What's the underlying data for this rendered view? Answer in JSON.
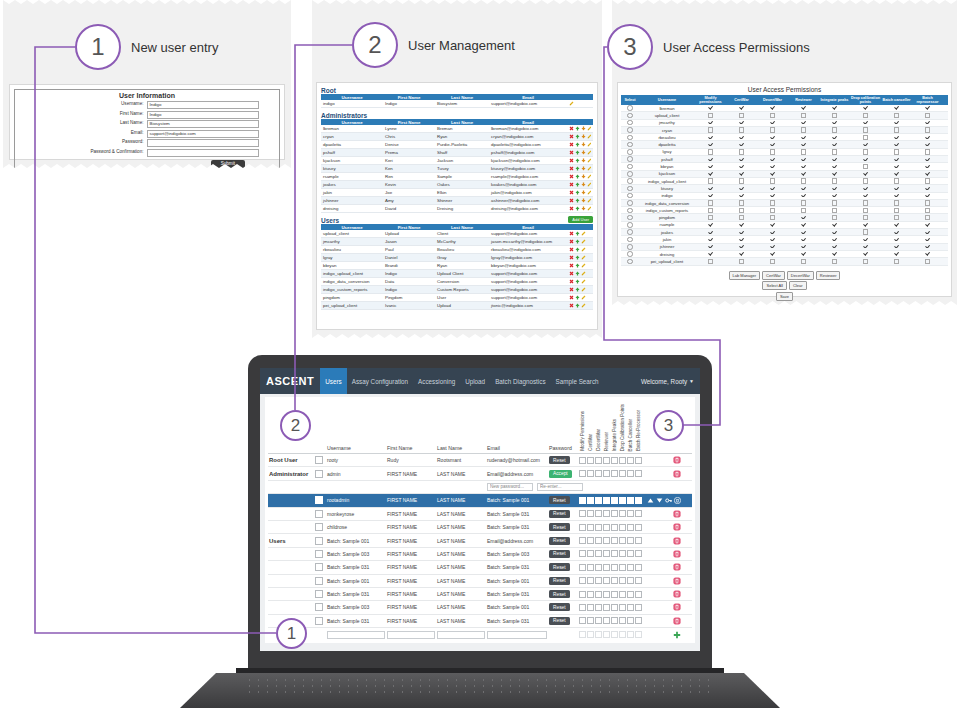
{
  "callouts": [
    {
      "number": "1",
      "title": "New user entry"
    },
    {
      "number": "2",
      "title": "User Management"
    },
    {
      "number": "3",
      "title": "User Access Permissions"
    }
  ],
  "new_user_form": {
    "title": "User Information",
    "fields": [
      {
        "label": "Username:",
        "value": "Indigo"
      },
      {
        "label": "First Name:",
        "value": "Indigo"
      },
      {
        "label": "Last Name:",
        "value": "Biosystem"
      },
      {
        "label": "Email:",
        "value": "support@indigobio.com"
      },
      {
        "label": "Password:",
        "value": ""
      },
      {
        "label": "Password & Confirmation:",
        "value": ""
      }
    ],
    "submit": "Submit"
  },
  "user_management": {
    "columns": [
      "Username",
      "First Name",
      "Last Name",
      "Email"
    ],
    "sections": [
      {
        "title": "Root",
        "kind": "root",
        "rows": [
          [
            "indigo",
            "Indigo",
            "Biosystem",
            "support@indigobio.com"
          ]
        ]
      },
      {
        "title": "Administrators",
        "kind": "admin",
        "rows": [
          [
            "lbreman",
            "Lynne",
            "Breman",
            "lbreman@indigobio.com"
          ],
          [
            "cryan",
            "Chris",
            "Ryan",
            "cryan@indigobio.com"
          ],
          [
            "dpaoletta",
            "Denise",
            "Purdie-Paoletta",
            "dpaoletta@indigobio.com"
          ],
          [
            "pshaff",
            "Prema",
            "Shaff",
            "pshaff@indigobio.com"
          ],
          [
            "kjackson",
            "Keri",
            "Jackson",
            "kjackson@indigobio.com"
          ],
          [
            "ktusey",
            "Ken",
            "Tusey",
            "ktusey@indigobio.com"
          ],
          [
            "rsample",
            "Ren",
            "Sample",
            "rsample@indigobio.com"
          ],
          [
            "joakes",
            "Kevin",
            "Oakes",
            "koakes@indigobio.com"
          ],
          [
            "jakin",
            "Joe",
            "Elkin",
            "jakin@indigobio.com"
          ],
          [
            "jshinner",
            "Amy",
            "Shinner",
            "ashinner@indigobio.com"
          ],
          [
            "dreising",
            "David",
            "Dreising",
            "dreising@indigobio.com"
          ]
        ]
      },
      {
        "title": "Users",
        "kind": "user",
        "add_button": "Add User",
        "rows": [
          [
            "upload_client",
            "Upload",
            "Client",
            "support@indigobio.com"
          ],
          [
            "jmcarthy",
            "Jason",
            "McCarthy",
            "jason.mccarthy@indigobio.com"
          ],
          [
            "rbeaulieu",
            "Paul",
            "Beaulieu",
            "rbeaulieu@indigobio.com"
          ],
          [
            "lgray",
            "Daniel",
            "Gray",
            "lgray@indigobio.com"
          ],
          [
            "bbryan",
            "Brandi",
            "Ryan",
            "bbryan@indigobio.com"
          ],
          [
            "indigo_upload_client",
            "Indigo",
            "Upload Client",
            "support@indigobio.com"
          ],
          [
            "indigo_data_conversion",
            "Data",
            "Conversion",
            "support@indigobio.com"
          ],
          [
            "indigo_custom_reports",
            "Indigo",
            "Custom Reports",
            "support@indigobio.com"
          ],
          [
            "pingdom",
            "Pingdom",
            "User",
            "support@indigobio.com"
          ],
          [
            "pei_upload_client",
            "Ivanic",
            "Upload",
            "jtonic@indigobio.com"
          ]
        ]
      }
    ]
  },
  "access_permissions": {
    "title": "User Access Permissions",
    "columns": [
      "Select",
      "Username",
      "Modify permissions",
      "CertWar",
      "DecertWar",
      "Reviewer",
      "Integrate peaks",
      "Drop calibration points",
      "Batch canceller",
      "Batch reprocessor"
    ],
    "rows": [
      {
        "username": "lbreman",
        "selected": false,
        "permissions": [
          true,
          true,
          true,
          true,
          true,
          true,
          true,
          true
        ]
      },
      {
        "username": "upload_client",
        "selected": false,
        "permissions": [
          false,
          false,
          false,
          false,
          false,
          false,
          false,
          false
        ]
      },
      {
        "username": "jmcarthy",
        "selected": false,
        "permissions": [
          true,
          true,
          true,
          true,
          true,
          true,
          true,
          true
        ]
      },
      {
        "username": "cryan",
        "selected": false,
        "permissions": [
          false,
          false,
          false,
          false,
          false,
          false,
          false,
          false
        ]
      },
      {
        "username": "rbeaulieu",
        "selected": false,
        "permissions": [
          true,
          true,
          true,
          true,
          true,
          false,
          true,
          true
        ]
      },
      {
        "username": "dpaoletta",
        "selected": false,
        "permissions": [
          true,
          true,
          true,
          true,
          true,
          true,
          true,
          true
        ]
      },
      {
        "username": "lgray",
        "selected": false,
        "permissions": [
          false,
          false,
          false,
          false,
          false,
          false,
          false,
          false
        ]
      },
      {
        "username": "pshaff",
        "selected": false,
        "permissions": [
          true,
          true,
          true,
          true,
          true,
          true,
          true,
          true
        ]
      },
      {
        "username": "bbryan",
        "selected": false,
        "permissions": [
          true,
          true,
          true,
          true,
          true,
          false,
          true,
          true
        ]
      },
      {
        "username": "kjackson",
        "selected": false,
        "permissions": [
          true,
          true,
          true,
          true,
          true,
          true,
          true,
          true
        ]
      },
      {
        "username": "indigo_upload_client",
        "selected": false,
        "permissions": [
          false,
          false,
          false,
          false,
          false,
          false,
          false,
          false
        ]
      },
      {
        "username": "ktusey",
        "selected": false,
        "permissions": [
          true,
          true,
          true,
          true,
          true,
          true,
          true,
          true
        ]
      },
      {
        "username": "indigo",
        "selected": false,
        "permissions": [
          true,
          true,
          true,
          true,
          true,
          true,
          true,
          true
        ]
      },
      {
        "username": "indigo_data_conversion",
        "selected": false,
        "permissions": [
          false,
          false,
          false,
          false,
          false,
          false,
          false,
          false
        ]
      },
      {
        "username": "indigo_custom_reports",
        "selected": false,
        "permissions": [
          false,
          false,
          false,
          false,
          false,
          false,
          false,
          false
        ]
      },
      {
        "username": "pingdom",
        "selected": false,
        "permissions": [
          false,
          false,
          false,
          true,
          false,
          false,
          false,
          false
        ]
      },
      {
        "username": "rsample",
        "selected": false,
        "permissions": [
          true,
          true,
          true,
          true,
          true,
          true,
          true,
          true
        ]
      },
      {
        "username": "joakes",
        "selected": false,
        "permissions": [
          true,
          true,
          true,
          true,
          true,
          false,
          true,
          true
        ]
      },
      {
        "username": "jakin",
        "selected": false,
        "permissions": [
          true,
          true,
          true,
          true,
          true,
          true,
          true,
          true
        ]
      },
      {
        "username": "jshinner",
        "selected": false,
        "permissions": [
          true,
          true,
          true,
          true,
          true,
          true,
          true,
          true
        ]
      },
      {
        "username": "dreising",
        "selected": false,
        "permissions": [
          true,
          true,
          true,
          true,
          true,
          true,
          true,
          true
        ]
      },
      {
        "username": "pei_upload_client",
        "selected": false,
        "permissions": [
          false,
          false,
          false,
          false,
          false,
          false,
          false,
          false
        ]
      }
    ],
    "role_buttons": [
      "Lab Manager",
      "CertWar",
      "DecertWar",
      "Reviewer"
    ],
    "select_buttons": [
      "Select All",
      "Clear"
    ],
    "save_button": "Save"
  },
  "app": {
    "logo": "ASCENT",
    "tabs": [
      {
        "label": "Users",
        "selected": true
      },
      {
        "label": "Assay Configuration",
        "selected": false
      },
      {
        "label": "Accessioning",
        "selected": false
      },
      {
        "label": "Upload",
        "selected": false
      },
      {
        "label": "Batch Diagnostics",
        "selected": false
      },
      {
        "label": "Sample Search",
        "selected": false
      }
    ],
    "welcome": "Welcome, Rooty",
    "menu_caret": "▼",
    "columns": [
      "Username",
      "First Name",
      "Last Name",
      "Email",
      "Password"
    ],
    "permission_columns": [
      "Modify Permissions",
      "CertWar",
      "DecertWar",
      "Reviewer",
      "Integrate Peaks",
      "Drop Calibration Points",
      "Batch Canceller",
      "Batch Re-Processor"
    ],
    "groups": [
      {
        "label": "Root User",
        "rows": [
          {
            "kind": "user",
            "selected": false,
            "checked": false,
            "username": "rooty",
            "first_name": "Rudy",
            "last_name": "Rootsmant",
            "email": "rudenady@hotmail.com",
            "button": {
              "label": "Reset",
              "accept": false
            },
            "permissions": [
              false,
              false,
              false,
              false,
              false,
              false,
              false,
              false
            ]
          }
        ]
      },
      {
        "label": "Administrator",
        "rows": [
          {
            "kind": "user",
            "selected": false,
            "checked": false,
            "username": "admin",
            "first_name": "FIRST NAME",
            "last_name": "LAST NAME",
            "email": "Email@address.com",
            "button": {
              "label": "Accept",
              "accept": true
            },
            "permissions": [
              false,
              false,
              false,
              false,
              false,
              false,
              false,
              false
            ]
          },
          {
            "kind": "password",
            "selected": false,
            "placeholders": [
              "New password...",
              "Re-enter..."
            ]
          },
          {
            "kind": "user",
            "selected": true,
            "checked": true,
            "username": "rootadmin",
            "first_name": "FIRST NAME",
            "last_name": "LAST NAME",
            "email": "Batch: Sample 001",
            "button": {
              "label": "Reset",
              "accept": false
            },
            "permissions": [
              true,
              true,
              true,
              true,
              true,
              true,
              true,
              true
            ]
          },
          {
            "kind": "user",
            "selected": false,
            "checked": false,
            "username": "monkeyrose",
            "first_name": "FIRST NAME",
            "last_name": "LAST NAME",
            "email": "Batch: Sample 031",
            "button": {
              "label": "Reset",
              "accept": false
            },
            "permissions": [
              false,
              false,
              false,
              false,
              false,
              false,
              false,
              false
            ]
          },
          {
            "kind": "user",
            "selected": false,
            "checked": false,
            "username": "childrose",
            "first_name": "FIRST NAME",
            "last_name": "LAST NAME",
            "email": "Batch: Sample 031",
            "button": {
              "label": "Reset",
              "accept": false
            },
            "permissions": [
              false,
              false,
              false,
              false,
              false,
              false,
              false,
              false
            ]
          }
        ]
      },
      {
        "label": "Users",
        "rows": [
          {
            "kind": "user",
            "selected": false,
            "checked": false,
            "username": "Batch: Sample 001",
            "first_name": "FIRST NAME",
            "last_name": "LAST NAME",
            "email": "Email@address.com",
            "button": {
              "label": "Reset",
              "accept": false
            },
            "permissions": [
              false,
              false,
              false,
              false,
              false,
              false,
              false,
              false
            ]
          },
          {
            "kind": "user",
            "selected": false,
            "checked": false,
            "username": "Batch: Sample 003",
            "first_name": "FIRST NAME",
            "last_name": "LAST NAME",
            "email": "Batch: Sample 003",
            "button": {
              "label": "Reset",
              "accept": false
            },
            "permissions": [
              false,
              false,
              false,
              false,
              false,
              false,
              false,
              false
            ]
          },
          {
            "kind": "user",
            "selected": false,
            "checked": false,
            "username": "Batch: Sample 031",
            "first_name": "FIRST NAME",
            "last_name": "LAST NAME",
            "email": "Batch: Sample 031",
            "button": {
              "label": "Reset",
              "accept": false
            },
            "permissions": [
              false,
              false,
              false,
              false,
              false,
              false,
              false,
              false
            ]
          },
          {
            "kind": "user",
            "selected": false,
            "checked": false,
            "username": "Batch: Sample 001",
            "first_name": "FIRST NAME",
            "last_name": "LAST NAME",
            "email": "Batch: Sample 001",
            "button": {
              "label": "Reset",
              "accept": false
            },
            "permissions": [
              false,
              false,
              false,
              false,
              false,
              false,
              false,
              false
            ]
          },
          {
            "kind": "user",
            "selected": false,
            "checked": false,
            "username": "Batch: Sample 031",
            "first_name": "FIRST NAME",
            "last_name": "LAST NAME",
            "email": "Batch: Sample 031",
            "button": {
              "label": "Reset",
              "accept": false
            },
            "permissions": [
              false,
              false,
              false,
              false,
              false,
              false,
              false,
              false
            ]
          },
          {
            "kind": "user",
            "selected": false,
            "checked": false,
            "username": "Batch: Sample 003",
            "first_name": "FIRST NAME",
            "last_name": "LAST NAME",
            "email": "Batch: Sample 001",
            "button": {
              "label": "Reset",
              "accept": false
            },
            "permissions": [
              false,
              false,
              false,
              false,
              false,
              false,
              false,
              false
            ]
          },
          {
            "kind": "user",
            "selected": false,
            "checked": false,
            "username": "Batch: Sample 031",
            "first_name": "FIRST NAME",
            "last_name": "LAST NAME",
            "email": "Batch: Sample 031",
            "button": {
              "label": "Reset",
              "accept": false
            },
            "permissions": [
              false,
              false,
              false,
              false,
              false,
              false,
              false,
              false
            ]
          }
        ]
      }
    ],
    "new_user_row": {
      "values": [
        "",
        "",
        "",
        ""
      ],
      "permissions": [
        false,
        false,
        false,
        false,
        false,
        false,
        false,
        false
      ]
    }
  }
}
